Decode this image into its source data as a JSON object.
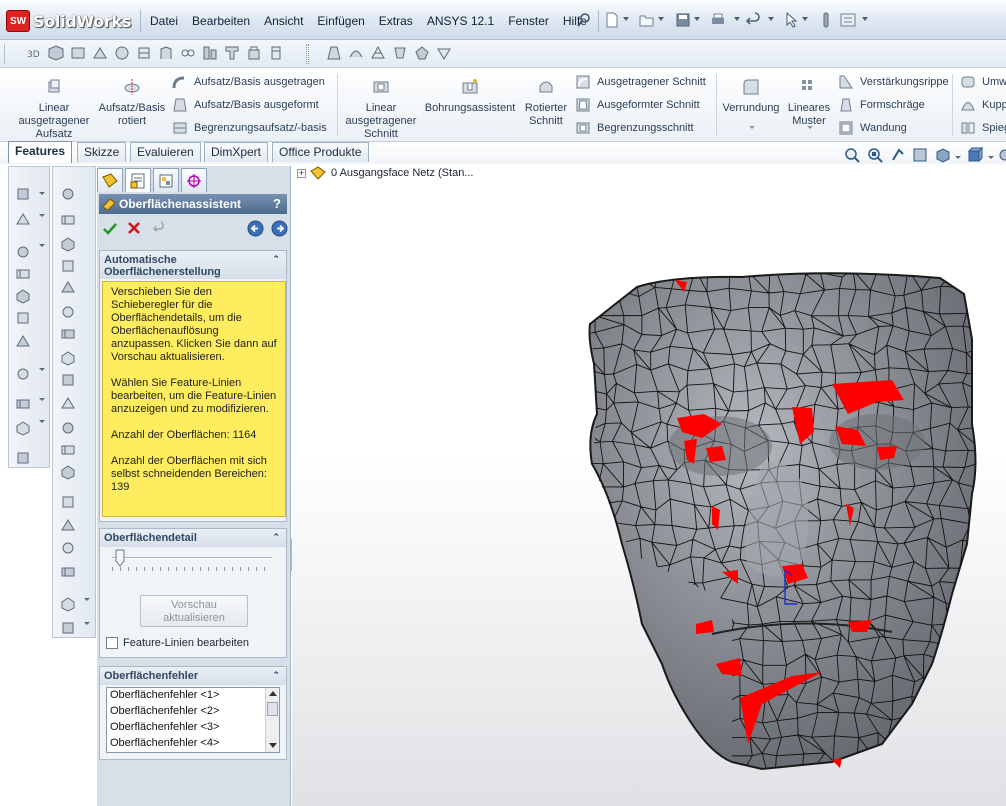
{
  "app": {
    "logo_text": "SolidWorks",
    "logo_badge": "SW"
  },
  "menu": [
    "Datei",
    "Bearbeiten",
    "Ansicht",
    "Einfügen",
    "Extras",
    "ANSYS 12.1",
    "Fenster",
    "Hilfe"
  ],
  "ribbon": {
    "big_buttons": [
      {
        "label": "Linear ausgetragener Aufsatz",
        "icon": "extruded-boss-icon"
      },
      {
        "label": "Aufsatz/Basis rotiert",
        "icon": "revolved-boss-icon"
      },
      {
        "label": "Linear ausgetragener Schnitt",
        "icon": "extruded-cut-icon"
      },
      {
        "label": "Bohrungsassistent",
        "icon": "hole-wizard-icon"
      },
      {
        "label": "Rotierter Schnitt",
        "icon": "revolved-cut-icon"
      },
      {
        "label": "Verrundung",
        "icon": "fillet-icon"
      },
      {
        "label": "Lineares Muster",
        "icon": "linear-pattern-icon"
      }
    ],
    "small_col1": [
      "Aufsatz/Basis ausgetragen",
      "Aufsatz/Basis ausgeformt",
      "Begrenzungsaufsatz/-basis"
    ],
    "small_col2": [
      "Ausgetragener Schnitt",
      "Ausgeformter Schnitt",
      "Begrenzungsschnitt"
    ],
    "small_col3": [
      "Verstärkungsrippe",
      "Formschräge",
      "Wandung"
    ],
    "small_col4": [
      "Umwi",
      "Kupp",
      "Spieg"
    ]
  },
  "tabs": [
    "Features",
    "Skizze",
    "Evaluieren",
    "DimXpert",
    "Office Produkte"
  ],
  "active_tab": "Features",
  "property_manager": {
    "title": "Oberflächenassistent",
    "help": "?",
    "group_auto": {
      "header": "Automatische Oberflächenerstellung",
      "messages": [
        "Verschieben Sie den Schieberegler für die Oberflächendetails, um die Oberflächenauflösung anzupassen. Klicken Sie dann auf Vorschau aktualisieren.",
        "Wählen Sie Feature-Linien bearbeiten, um die Feature-Linien anzuzeigen und zu modifizieren.",
        "Anzahl der Oberflächen: 1164",
        "Anzahl der Oberflächen mit sich selbst schneidenden Bereichen: 139"
      ]
    },
    "group_detail": {
      "header": "Oberflächendetail",
      "slider_value": 0.02,
      "preview_button": "Vorschau aktualisieren",
      "checkbox_label": "Feature-Linien bearbeiten",
      "checkbox_checked": false
    },
    "group_errors": {
      "header": "Oberflächenfehler",
      "items": [
        "Oberflächenfehler <1>",
        "Oberflächenfehler <2>",
        "Oberflächenfehler <3>",
        "Oberflächenfehler <4>"
      ]
    }
  },
  "tree": {
    "item": "0 Ausgangsface Netz  (Stan..."
  },
  "colors": {
    "accent_blue": "#4d6a8e",
    "message_yellow": "#ffed5f",
    "mesh_gray": "#7d8187",
    "error_red": "#ff0000"
  }
}
